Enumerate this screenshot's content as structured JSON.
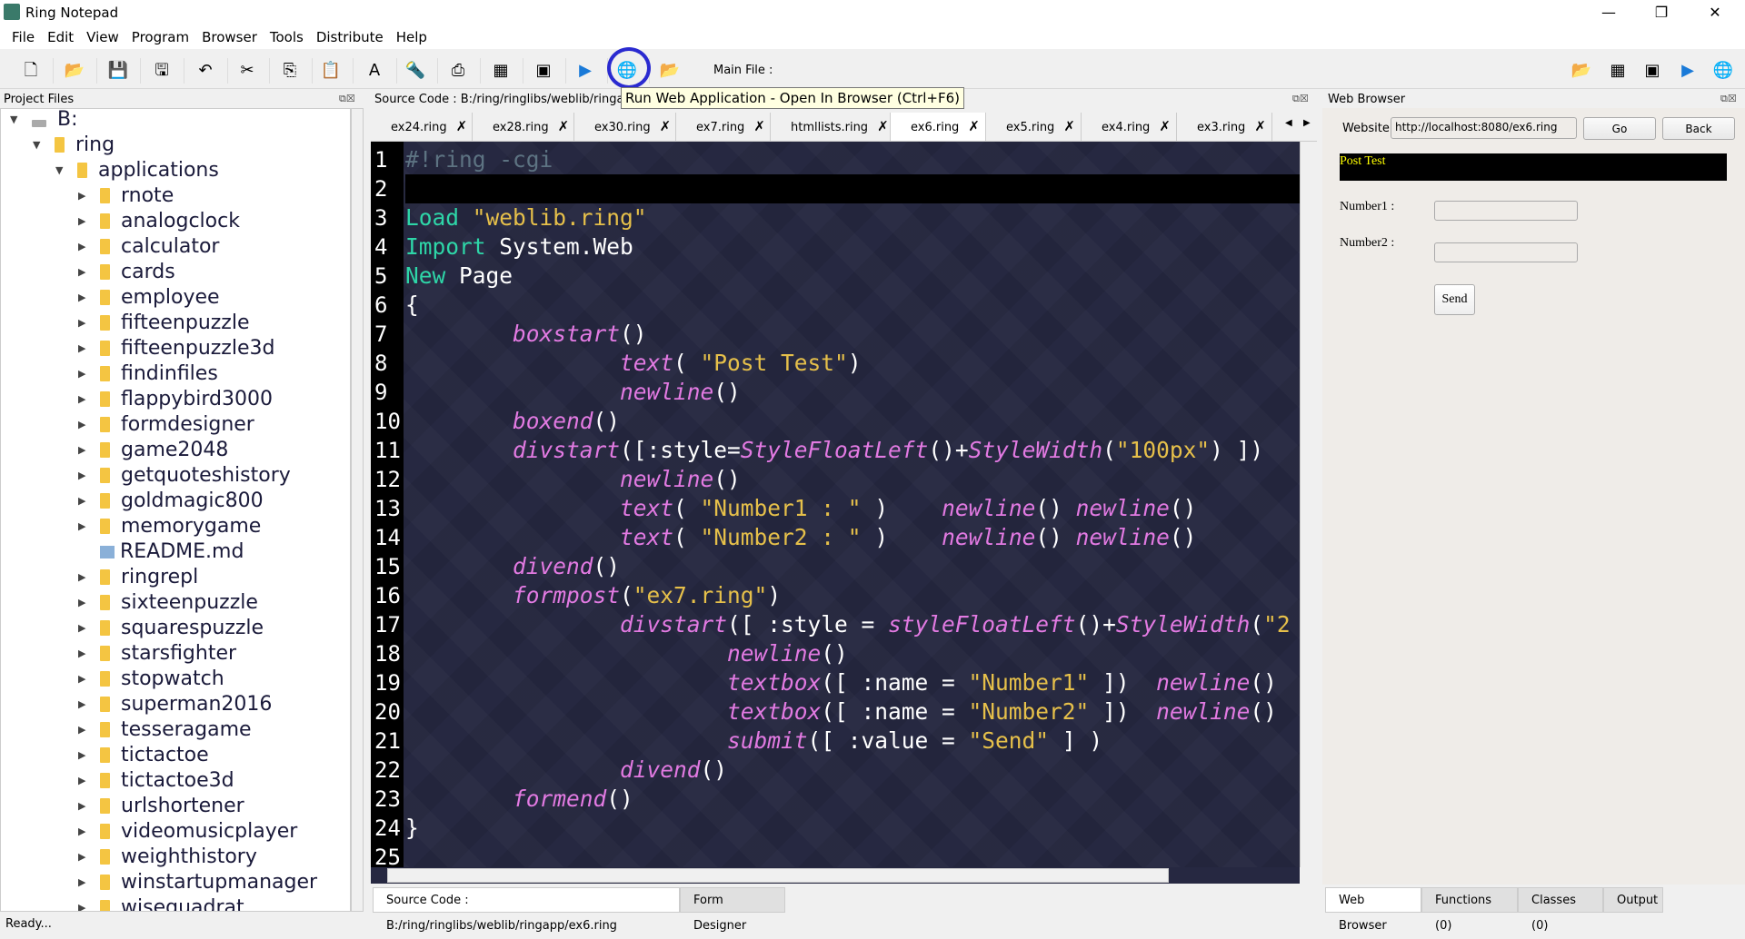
{
  "window": {
    "title": "Ring Notepad",
    "minimize": "—",
    "maximize": "❐",
    "close": "✕"
  },
  "menu": [
    "File",
    "Edit",
    "View",
    "Program",
    "Browser",
    "Tools",
    "Distribute",
    "Help"
  ],
  "toolbar": {
    "main_file_label": "Main File :",
    "tooltip": "Run Web Application - Open In Browser (Ctrl+F6)",
    "icons": [
      {
        "name": "new-file-icon",
        "g": "🗋"
      },
      {
        "name": "open-folder-icon",
        "g": "📂"
      },
      {
        "name": "save-icon",
        "g": "💾"
      },
      {
        "name": "save-as-icon",
        "g": "🖫"
      },
      {
        "name": "undo-icon",
        "g": "↶"
      },
      {
        "name": "cut-icon",
        "g": "✂"
      },
      {
        "name": "copy-icon",
        "g": "⎘"
      },
      {
        "name": "paste-icon",
        "g": "📋"
      },
      {
        "name": "font-icon",
        "g": "A"
      },
      {
        "name": "find-icon",
        "g": "🔦"
      },
      {
        "name": "print-icon",
        "g": "⎙"
      },
      {
        "name": "calculator-icon",
        "g": "▦"
      },
      {
        "name": "debug-icon",
        "g": "▣"
      },
      {
        "name": "run-icon",
        "g": "▶"
      },
      {
        "name": "run-web-globe-icon",
        "g": "🌐"
      },
      {
        "name": "open-project-icon",
        "g": "📂"
      }
    ],
    "right_icons": [
      {
        "name": "open-folder-icon",
        "g": "📂"
      },
      {
        "name": "calculator-icon",
        "g": "▦"
      },
      {
        "name": "debug-icon",
        "g": "▣"
      },
      {
        "name": "run-icon",
        "g": "▶"
      },
      {
        "name": "run-web-globe-icon",
        "g": "🌐"
      }
    ]
  },
  "project": {
    "title": "Project Files",
    "tree": [
      {
        "l": 0,
        "t": "drive",
        "label": "B:",
        "open": true
      },
      {
        "l": 1,
        "t": "folder",
        "label": "ring",
        "open": true
      },
      {
        "l": 2,
        "t": "folder",
        "label": "applications",
        "open": true
      },
      {
        "l": 3,
        "t": "folder",
        "label": "rnote"
      },
      {
        "l": 3,
        "t": "folder",
        "label": "analogclock"
      },
      {
        "l": 3,
        "t": "folder",
        "label": "calculator"
      },
      {
        "l": 3,
        "t": "folder",
        "label": "cards"
      },
      {
        "l": 3,
        "t": "folder",
        "label": "employee"
      },
      {
        "l": 3,
        "t": "folder",
        "label": "fifteenpuzzle"
      },
      {
        "l": 3,
        "t": "folder",
        "label": "fifteenpuzzle3d"
      },
      {
        "l": 3,
        "t": "folder",
        "label": "findinfiles"
      },
      {
        "l": 3,
        "t": "folder",
        "label": "flappybird3000"
      },
      {
        "l": 3,
        "t": "folder",
        "label": "formdesigner"
      },
      {
        "l": 3,
        "t": "folder",
        "label": "game2048"
      },
      {
        "l": 3,
        "t": "folder",
        "label": "getquoteshistory"
      },
      {
        "l": 3,
        "t": "folder",
        "label": "goldmagic800"
      },
      {
        "l": 3,
        "t": "folder",
        "label": "memorygame"
      },
      {
        "l": 3,
        "t": "file",
        "label": "README.md"
      },
      {
        "l": 3,
        "t": "folder",
        "label": "ringrepl"
      },
      {
        "l": 3,
        "t": "folder",
        "label": "sixteenpuzzle"
      },
      {
        "l": 3,
        "t": "folder",
        "label": "squarespuzzle"
      },
      {
        "l": 3,
        "t": "folder",
        "label": "starsfighter"
      },
      {
        "l": 3,
        "t": "folder",
        "label": "stopwatch"
      },
      {
        "l": 3,
        "t": "folder",
        "label": "superman2016"
      },
      {
        "l": 3,
        "t": "folder",
        "label": "tesseragame"
      },
      {
        "l": 3,
        "t": "folder",
        "label": "tictactoe"
      },
      {
        "l": 3,
        "t": "folder",
        "label": "tictactoe3d"
      },
      {
        "l": 3,
        "t": "folder",
        "label": "urlshortener"
      },
      {
        "l": 3,
        "t": "folder",
        "label": "videomusicplayer"
      },
      {
        "l": 3,
        "t": "folder",
        "label": "weighthistory"
      },
      {
        "l": 3,
        "t": "folder",
        "label": "winstartupmanager"
      },
      {
        "l": 3,
        "t": "folder",
        "label": "wisequadrat"
      }
    ]
  },
  "editor": {
    "title": "Source Code : B:/ring/ringlibs/weblib/ringapp/e",
    "tabs": [
      {
        "label": "ex24.ring"
      },
      {
        "label": "ex28.ring"
      },
      {
        "label": "ex30.ring"
      },
      {
        "label": "ex7.ring"
      },
      {
        "label": "htmllists.ring"
      },
      {
        "label": "ex6.ring",
        "active": true
      },
      {
        "label": "ex5.ring"
      },
      {
        "label": "ex4.ring"
      },
      {
        "label": "ex3.ring"
      }
    ],
    "close_glyph": "✗",
    "lines": [
      [
        [
          "c",
          "#!ring -cgi"
        ]
      ],
      [],
      [
        [
          "k",
          "Load "
        ],
        [
          "s",
          "\"weblib.ring\""
        ]
      ],
      [
        [
          "k",
          "Import "
        ],
        [
          "p",
          "System.Web"
        ]
      ],
      [
        [
          "k",
          "New "
        ],
        [
          "p",
          "Page"
        ]
      ],
      [
        [
          "p",
          "{"
        ]
      ],
      [
        [
          "p",
          "        "
        ],
        [
          "f",
          "boxstart"
        ],
        [
          "p",
          "()"
        ]
      ],
      [
        [
          "p",
          "                "
        ],
        [
          "f",
          "text"
        ],
        [
          "p",
          "( "
        ],
        [
          "s",
          "\"Post Test\""
        ],
        [
          "p",
          ")"
        ]
      ],
      [
        [
          "p",
          "                "
        ],
        [
          "f",
          "newline"
        ],
        [
          "p",
          "()"
        ]
      ],
      [
        [
          "p",
          "        "
        ],
        [
          "f",
          "boxend"
        ],
        [
          "p",
          "()"
        ]
      ],
      [
        [
          "p",
          "        "
        ],
        [
          "f",
          "divstart"
        ],
        [
          "p",
          "([:style="
        ],
        [
          "f",
          "StyleFloatLeft"
        ],
        [
          "p",
          "()+"
        ],
        [
          "f",
          "StyleWidth"
        ],
        [
          "p",
          "("
        ],
        [
          "s",
          "\"100px\""
        ],
        [
          "p",
          ") ])"
        ]
      ],
      [
        [
          "p",
          "                "
        ],
        [
          "f",
          "newline"
        ],
        [
          "p",
          "()"
        ]
      ],
      [
        [
          "p",
          "                "
        ],
        [
          "f",
          "text"
        ],
        [
          "p",
          "( "
        ],
        [
          "s",
          "\"Number1 : \""
        ],
        [
          "p",
          " )    "
        ],
        [
          "f",
          "newline"
        ],
        [
          "p",
          "() "
        ],
        [
          "f",
          "newline"
        ],
        [
          "p",
          "()"
        ]
      ],
      [
        [
          "p",
          "                "
        ],
        [
          "f",
          "text"
        ],
        [
          "p",
          "( "
        ],
        [
          "s",
          "\"Number2 : \""
        ],
        [
          "p",
          " )    "
        ],
        [
          "f",
          "newline"
        ],
        [
          "p",
          "() "
        ],
        [
          "f",
          "newline"
        ],
        [
          "p",
          "()"
        ]
      ],
      [
        [
          "p",
          "        "
        ],
        [
          "f",
          "divend"
        ],
        [
          "p",
          "()"
        ]
      ],
      [
        [
          "p",
          "        "
        ],
        [
          "f",
          "formpost"
        ],
        [
          "p",
          "("
        ],
        [
          "s",
          "\"ex7.ring\""
        ],
        [
          "p",
          ")"
        ]
      ],
      [
        [
          "p",
          "                "
        ],
        [
          "f",
          "divstart"
        ],
        [
          "p",
          "([ :style = "
        ],
        [
          "f",
          "styleFloatLeft"
        ],
        [
          "p",
          "()+"
        ],
        [
          "f",
          "StyleWidth"
        ],
        [
          "p",
          "("
        ],
        [
          "s",
          "\"2"
        ]
      ],
      [
        [
          "p",
          "                        "
        ],
        [
          "f",
          "newline"
        ],
        [
          "p",
          "()"
        ]
      ],
      [
        [
          "p",
          "                        "
        ],
        [
          "f",
          "textbox"
        ],
        [
          "p",
          "([ :name = "
        ],
        [
          "s",
          "\"Number1\""
        ],
        [
          "p",
          " ])  "
        ],
        [
          "f",
          "newline"
        ],
        [
          "p",
          "()"
        ]
      ],
      [
        [
          "p",
          "                        "
        ],
        [
          "f",
          "textbox"
        ],
        [
          "p",
          "([ :name = "
        ],
        [
          "s",
          "\"Number2\""
        ],
        [
          "p",
          " ])  "
        ],
        [
          "f",
          "newline"
        ],
        [
          "p",
          "()"
        ]
      ],
      [
        [
          "p",
          "                        "
        ],
        [
          "f",
          "submit"
        ],
        [
          "p",
          "([ :value = "
        ],
        [
          "s",
          "\"Send\""
        ],
        [
          "p",
          " ] )"
        ]
      ],
      [
        [
          "p",
          "                "
        ],
        [
          "f",
          "divend"
        ],
        [
          "p",
          "()"
        ]
      ],
      [
        [
          "p",
          "        "
        ],
        [
          "f",
          "formend"
        ],
        [
          "p",
          "()"
        ]
      ],
      [
        [
          "p",
          "}"
        ]
      ],
      []
    ],
    "current_line": 2,
    "bottom_tabs": [
      {
        "label": "Source Code : B:/ring/ringlibs/weblib/ringapp/ex6.ring",
        "active": true
      },
      {
        "label": "Form Designer"
      }
    ]
  },
  "browser": {
    "title": "Web Browser",
    "website_label": "Website:",
    "url": "http://localhost:8080/ex6.ring",
    "go": "Go",
    "back": "Back",
    "page": {
      "heading": "Post Test",
      "number1_label": "Number1 :",
      "number2_label": "Number2 :",
      "send": "Send"
    },
    "bottom_tabs": [
      {
        "label": "Web Browser",
        "active": true
      },
      {
        "label": "Functions (0)"
      },
      {
        "label": "Classes (0)"
      },
      {
        "label": "Output"
      }
    ]
  },
  "status": "Ready...",
  "colors": {
    "keyword": "#2ed6a8",
    "string": "#e6c04a",
    "function": "#e27ae2",
    "comment": "#5d7382",
    "editor_bg": "#262841",
    "highlight_circle": "#2a2ad0"
  }
}
